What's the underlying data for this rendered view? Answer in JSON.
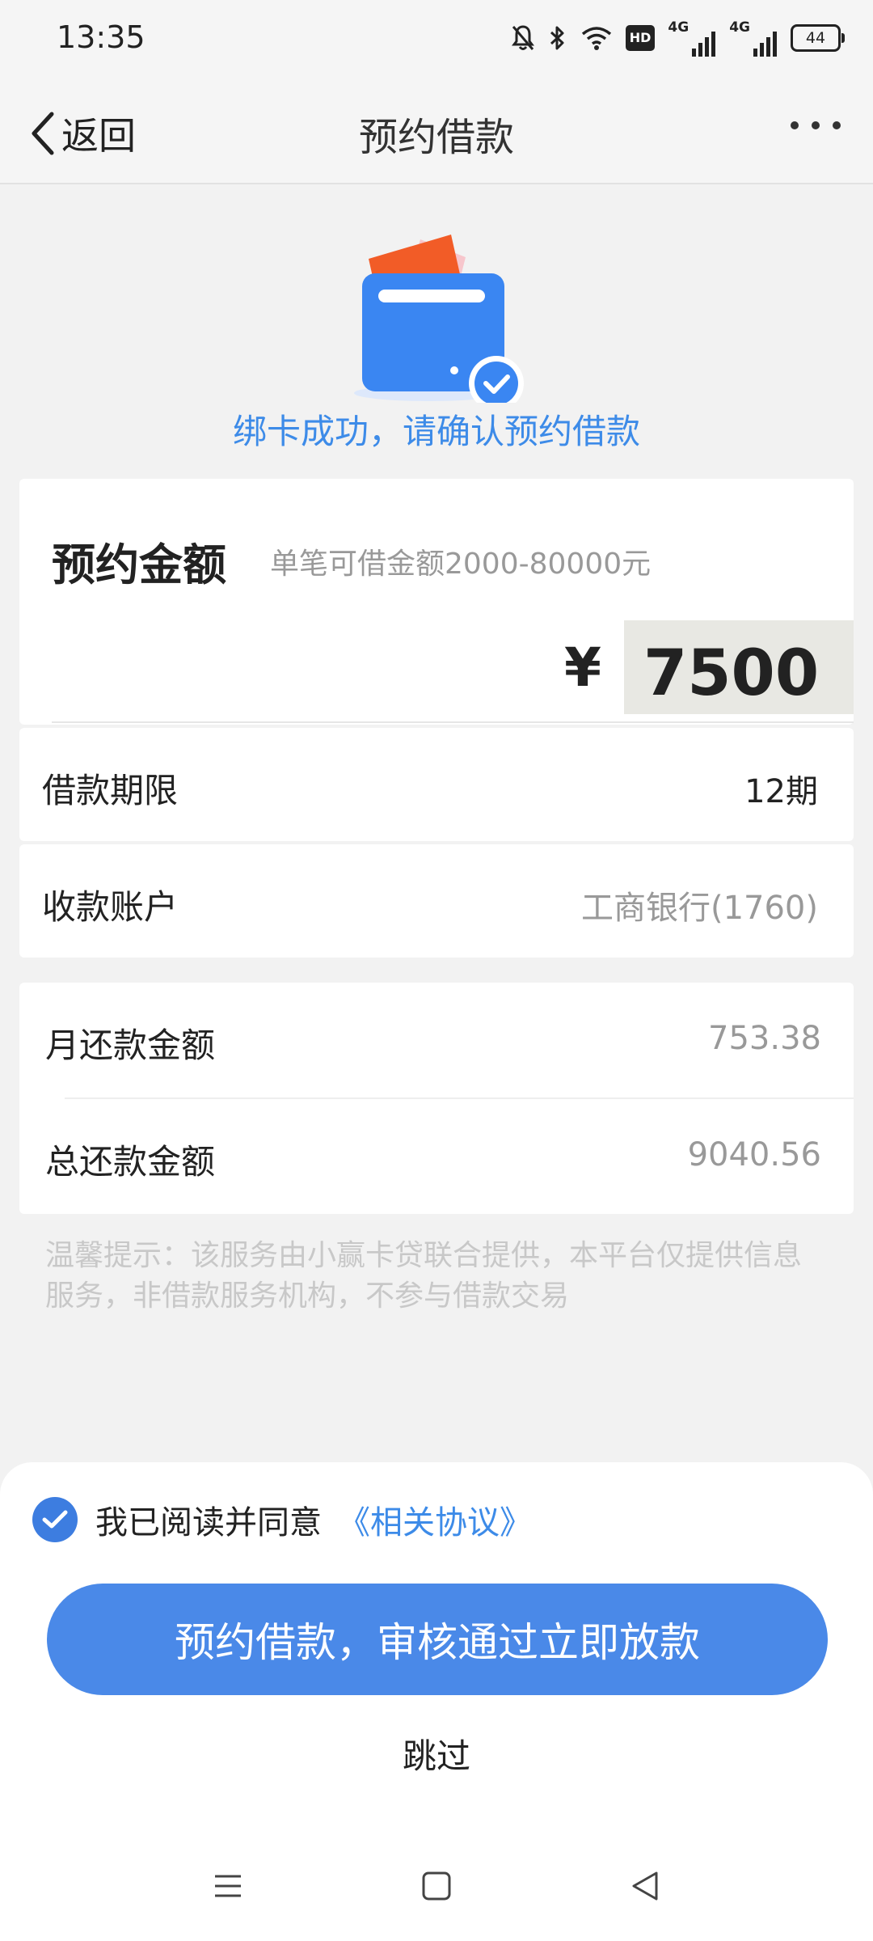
{
  "status_bar": {
    "time": "13:35",
    "icons": [
      "mute-bell-icon",
      "bluetooth-icon",
      "wifi-icon",
      "hd-icon",
      "signal-4g-icon",
      "signal-4g-icon",
      "battery-icon"
    ],
    "hd_label": "HD",
    "net_label_1": "4G",
    "net_label_2": "4G",
    "battery_level": "44"
  },
  "nav": {
    "back_label": "返回",
    "title": "预约借款",
    "more_icon": "more-dots-icon"
  },
  "hero": {
    "illustration": "bank-card-check-icon",
    "message": "绑卡成功，请确认预约借款"
  },
  "amount": {
    "title": "预约金额",
    "hint": "单笔可借金额2000-80000元",
    "currency": "¥",
    "value": "7500"
  },
  "term": {
    "label": "借款期限",
    "value": "12期"
  },
  "account": {
    "label": "收款账户",
    "value": "工商银行(1760)"
  },
  "repayment": {
    "monthly_label": "月还款金额",
    "monthly_value": "753.38",
    "total_label": "总还款金额",
    "total_value": "9040.56"
  },
  "tip": "温馨提示：该服务由小赢卡贷联合提供，本平台仅提供信息服务，非借款服务机构，不参与借款交易",
  "agreement": {
    "checked": true,
    "text": "我已阅读并同意",
    "link": "《相关协议》"
  },
  "actions": {
    "primary": "预约借款，审核通过立即放款",
    "skip": "跳过"
  },
  "system_nav": [
    "menu-icon",
    "home-square-icon",
    "back-triangle-icon"
  ],
  "colors": {
    "accent": "#4a89e8",
    "link": "#3d8be8",
    "background": "#f2f2f2"
  }
}
